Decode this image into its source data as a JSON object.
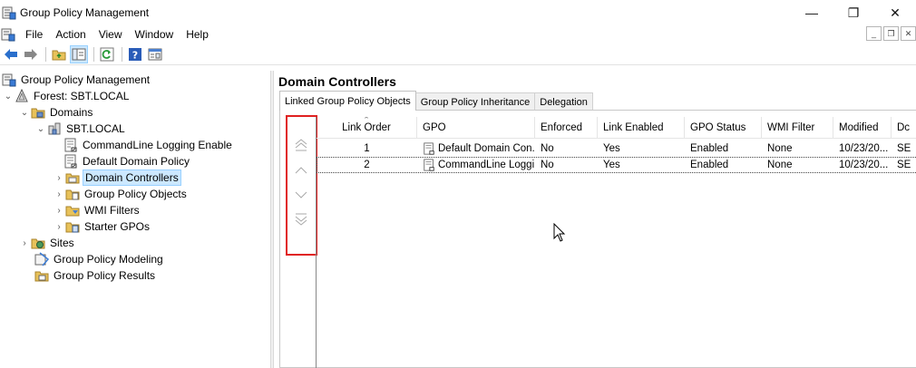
{
  "window": {
    "title": "Group Policy Management",
    "minimize_glyph": "—",
    "maximize_glyph": "❐",
    "close_glyph": "✕"
  },
  "menu": [
    "File",
    "Action",
    "View",
    "Window",
    "Help"
  ],
  "mdi_controls": [
    "_",
    "❐",
    "✕"
  ],
  "toolbar": {
    "icons": [
      "back-arrow-icon",
      "forward-arrow-icon",
      "folder-up-icon",
      "show-hide-tree-icon",
      "refresh-icon",
      "help-icon",
      "properties-icon"
    ]
  },
  "tree": {
    "root": "Group Policy Management",
    "forest": "Forest: SBT.LOCAL",
    "domains": "Domains",
    "domain": "SBT.LOCAL",
    "gpo_links": [
      "CommandLine Logging Enable",
      "Default Domain Policy"
    ],
    "domain_controllers": "Domain Controllers",
    "group_policy_objects": "Group Policy Objects",
    "wmi_filters": "WMI Filters",
    "starter_gpos": "Starter GPOs",
    "sites": "Sites",
    "modeling": "Group Policy Modeling",
    "results": "Group Policy Results"
  },
  "right": {
    "title": "Domain Controllers",
    "tabs": [
      "Linked Group Policy Objects",
      "Group Policy Inheritance",
      "Delegation"
    ],
    "active_tab": 0,
    "columns": [
      "Link Order",
      "GPO",
      "Enforced",
      "Link Enabled",
      "GPO Status",
      "WMI Filter",
      "Modified",
      "Dc"
    ],
    "rows": [
      {
        "link_order": "1",
        "gpo": "Default Domain Con...",
        "enforced": "No",
        "link_enabled": "Yes",
        "gpo_status": "Enabled",
        "wmi_filter": "None",
        "modified": "10/23/20...",
        "domain": "SE"
      },
      {
        "link_order": "2",
        "gpo": "CommandLine Loggi...",
        "enforced": "No",
        "link_enabled": "Yes",
        "gpo_status": "Enabled",
        "wmi_filter": "None",
        "modified": "10/23/20...",
        "domain": "SE"
      }
    ]
  },
  "colors": {
    "selection_bg": "#cce8ff",
    "highlight_box": "#e02020"
  }
}
